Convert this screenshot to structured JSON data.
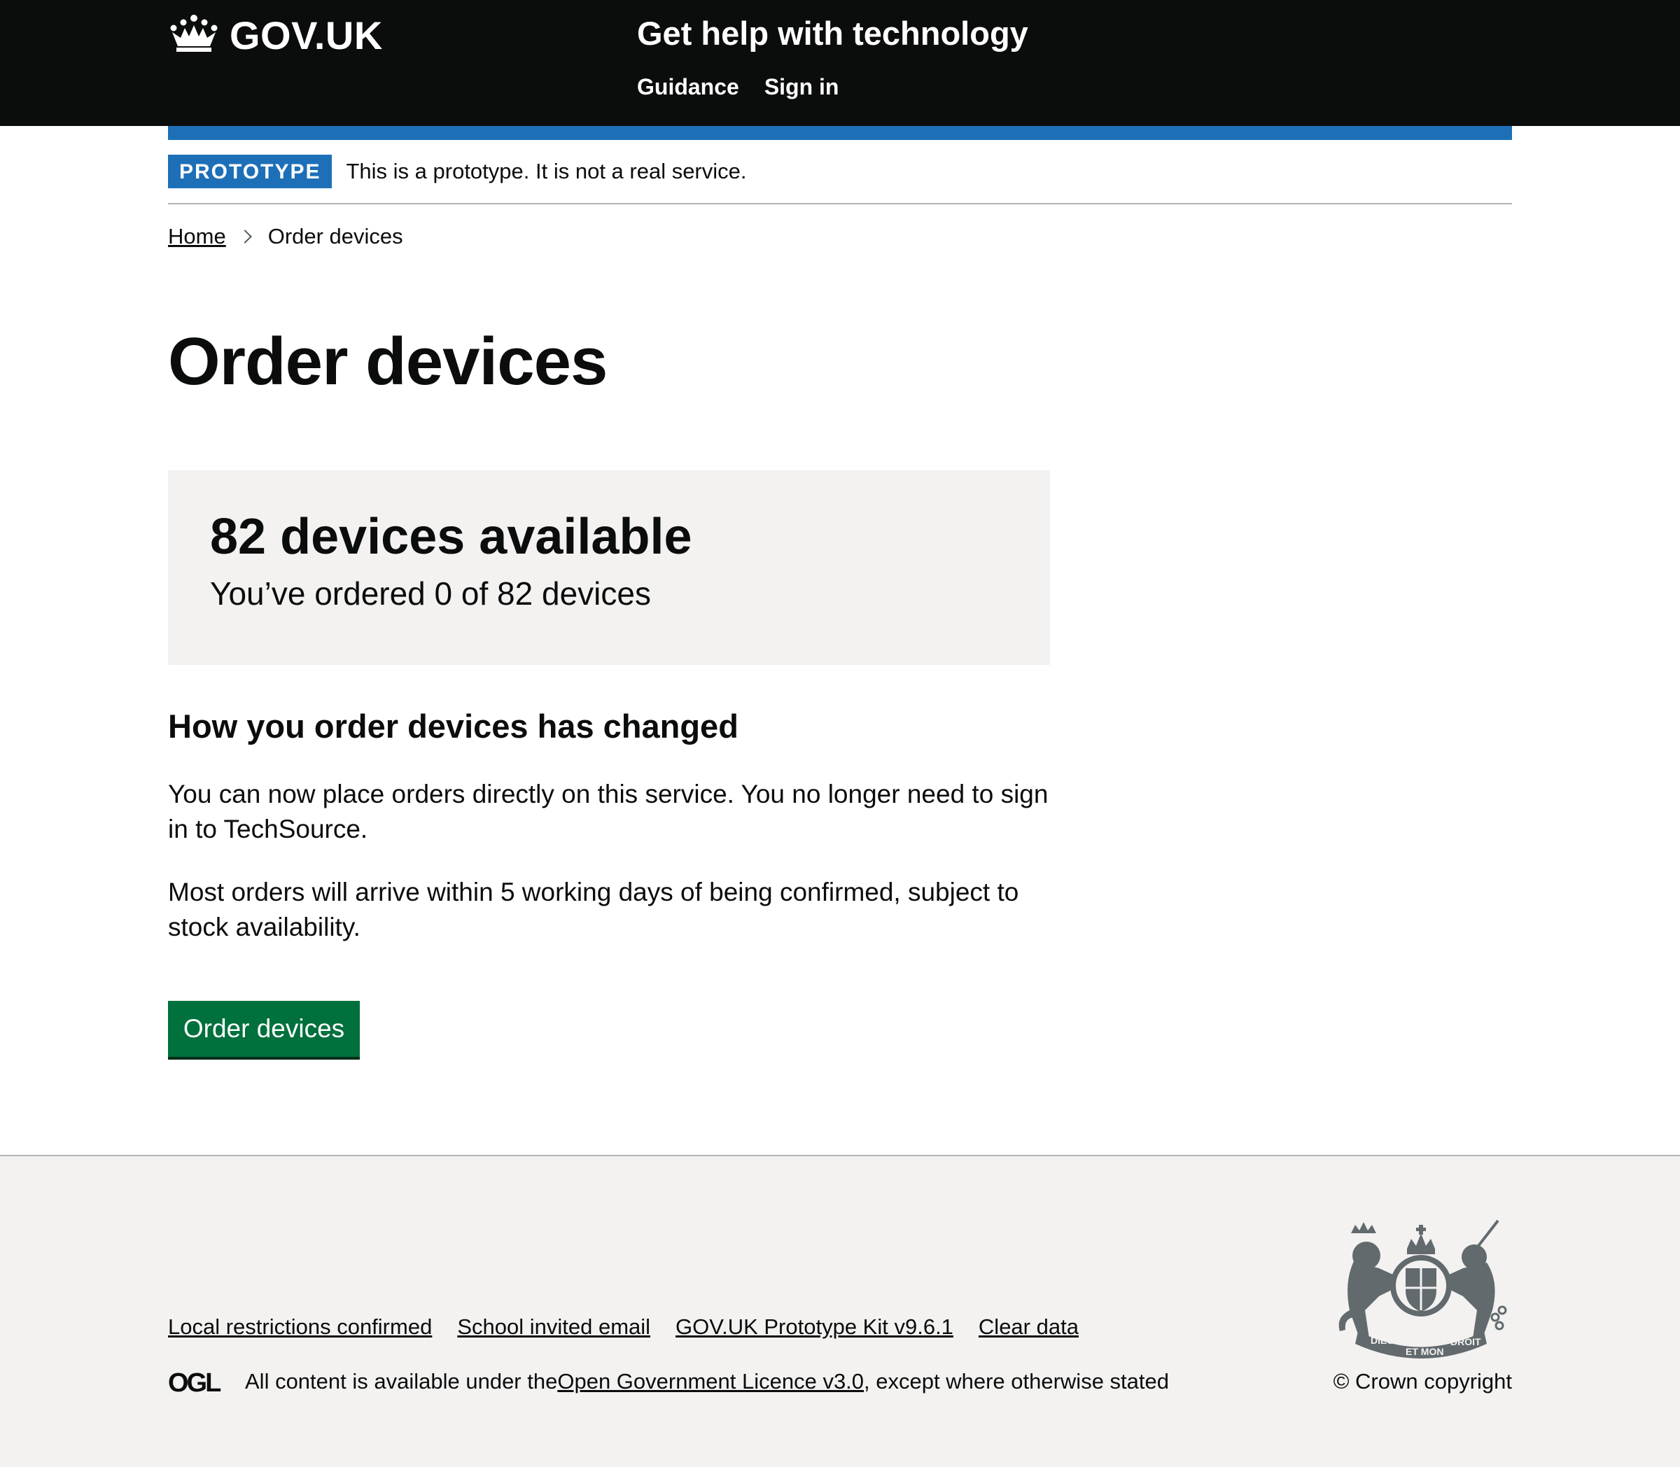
{
  "header": {
    "logo_text": "GOV.UK",
    "service_name": "Get help with technology",
    "nav": [
      "Guidance",
      "Sign in"
    ]
  },
  "phase_banner": {
    "tag": "PROTOTYPE",
    "text": "This is a prototype. It is not a real service."
  },
  "breadcrumbs": {
    "home": "Home",
    "current": "Order devices"
  },
  "main": {
    "title": "Order devices",
    "panel": {
      "title": "82 devices available",
      "subtitle": "You’ve ordered 0 of 82 devices"
    },
    "subheading": "How you order devices has changed",
    "paragraphs": [
      "You can now place orders directly on this service. You no longer need to sign in to TechSource.",
      "Most orders will arrive within 5 working days of being confirmed, subject to stock availability."
    ],
    "button_label": "Order devices"
  },
  "footer": {
    "links": [
      "Local restrictions confirmed",
      "School invited email",
      "GOV.UK Prototype Kit v9.6.1",
      "Clear data"
    ],
    "licence_prefix": "All content is available under the ",
    "licence_link": "Open Government Licence v3.0",
    "licence_suffix": ", except where otherwise stated",
    "ogl_logo": "OGL",
    "copyright": "© Crown copyright",
    "crest_motto": [
      "DIEU",
      "ET MON",
      "DROIT"
    ]
  },
  "colors": {
    "header_bg": "#0b0c0c",
    "brand_blue": "#1d70b8",
    "button_green": "#00703c",
    "panel_grey": "#f3f2f1"
  }
}
